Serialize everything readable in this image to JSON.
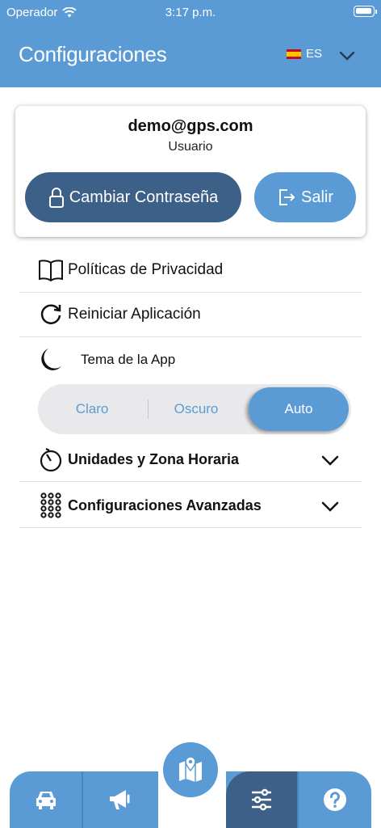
{
  "status": {
    "carrier": "Operador",
    "time": "3:17 p.m."
  },
  "header": {
    "title": "Configuraciones",
    "language": "ES"
  },
  "account": {
    "email": "demo@gps.com",
    "role": "Usuario",
    "change_password_label": "Cambiar Contraseña",
    "exit_label": "Salir"
  },
  "menu": {
    "privacy": "Políticas de Privacidad",
    "restart": "Reiniciar Aplicación",
    "theme": "Tema de la App",
    "units": "Unidades y Zona Horaria",
    "advanced": "Configuraciones Avanzadas"
  },
  "theme_options": {
    "light": "Claro",
    "dark": "Oscuro",
    "auto": "Auto",
    "selected": "Auto"
  },
  "tabs": [
    "car-icon",
    "megaphone-icon",
    "map-icon",
    "sliders-icon",
    "help-icon"
  ],
  "colors": {
    "primary": "#5b9bd5",
    "dark": "#3d6088"
  }
}
